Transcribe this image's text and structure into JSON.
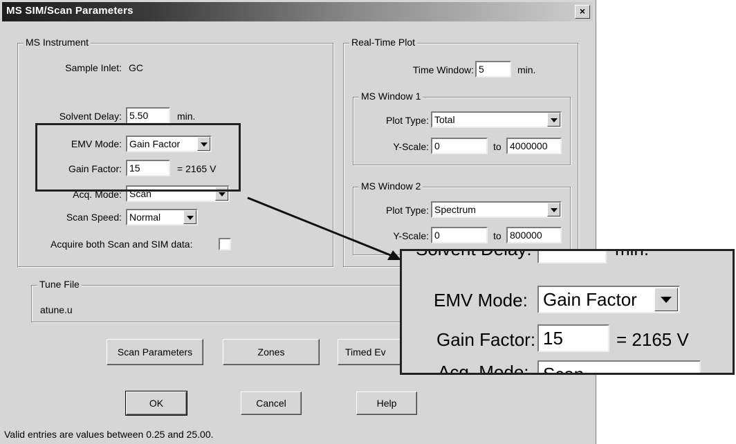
{
  "window": {
    "title": "MS SIM/Scan Parameters",
    "close_glyph": "×"
  },
  "ms_instrument": {
    "legend": "MS Instrument",
    "sample_inlet_label": "Sample Inlet:",
    "sample_inlet_value": "GC",
    "solvent_delay_label": "Solvent Delay:",
    "solvent_delay_value": "5.50",
    "solvent_delay_unit": "min.",
    "emv_mode_label": "EMV Mode:",
    "emv_mode_value": "Gain Factor",
    "gain_factor_label": "Gain Factor:",
    "gain_factor_value": "15",
    "gain_factor_voltage": "= 2165 V",
    "acq_mode_label": "Acq. Mode:",
    "acq_mode_value": "Scan",
    "scan_speed_label": "Scan Speed:",
    "scan_speed_value": "Normal",
    "acquire_both_label": "Acquire both Scan and SIM data:"
  },
  "real_time_plot": {
    "legend": "Real-Time Plot",
    "time_window_label": "Time Window:",
    "time_window_value": "5",
    "time_window_unit": "min.",
    "ms_window_1": {
      "legend": "MS Window 1",
      "plot_type_label": "Plot Type:",
      "plot_type_value": "Total",
      "y_scale_label": "Y-Scale:",
      "y_min": "0",
      "to_label": "to",
      "y_max": "4000000"
    },
    "ms_window_2": {
      "legend": "MS Window 2",
      "plot_type_label": "Plot Type:",
      "plot_type_value": "Spectrum",
      "y_scale_label": "Y-Scale:",
      "y_min": "0",
      "to_label": "to",
      "y_max": "800000"
    }
  },
  "tune_file": {
    "legend": "Tune File",
    "value": "atune.u"
  },
  "buttons": {
    "scan_parameters": "Scan Parameters",
    "zones": "Zones",
    "timed_events": "Timed Ev",
    "ok": "OK",
    "cancel": "Cancel",
    "help": "Help"
  },
  "status_text": "Valid entries are values between 0.25 and 25.00.",
  "zoom": {
    "partial_top_label": "Solvent Delay:",
    "partial_top_unit": "min.",
    "emv_mode_label": "EMV Mode:",
    "emv_mode_value": "Gain Factor",
    "gain_factor_label": "Gain Factor:",
    "gain_factor_value": "15",
    "gain_factor_voltage": "= 2165 V",
    "partial_bottom_label": "Acq. Mode:",
    "partial_bottom_value": "Scan"
  }
}
